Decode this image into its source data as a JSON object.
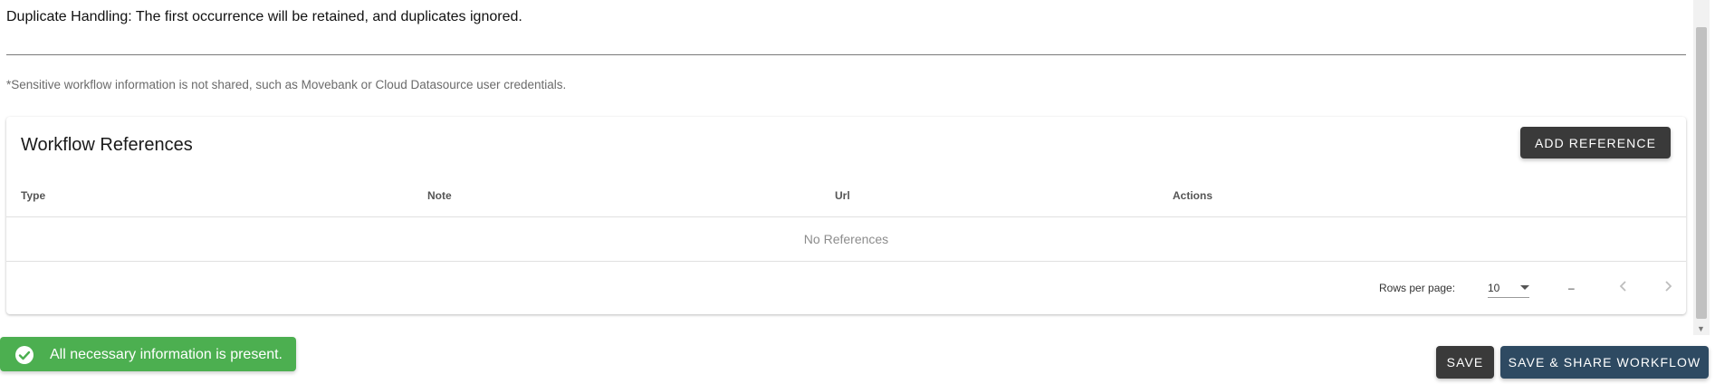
{
  "duplicate_handling": "Duplicate Handling: The first occurrence will be retained, and duplicates ignored.",
  "sensitive_note": "*Sensitive workflow information is not shared, such as Movebank or Cloud Datasource user credentials.",
  "references": {
    "title": "Workflow References",
    "add_button_label": "ADD REFERENCE",
    "columns": [
      "Type",
      "Note",
      "Url",
      "Actions"
    ],
    "empty_text": "No References",
    "pagination": {
      "rows_per_page_label": "Rows per page:",
      "rows_per_page_value": "10",
      "range_text": "–",
      "prev_icon": "chevron-left-icon",
      "next_icon": "chevron-right-icon"
    }
  },
  "toast": {
    "icon": "check-circle-icon",
    "text": "All necessary information is present.",
    "color": "#4caf50"
  },
  "actions": {
    "save_label": "SAVE",
    "save_share_label": "SAVE & SHARE WORKFLOW",
    "save_color": "#3a3a3a",
    "save_share_color": "#2e4a62"
  }
}
